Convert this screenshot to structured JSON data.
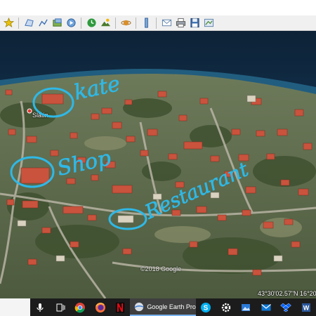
{
  "map": {
    "place_label": "Slatin",
    "copyright": "©2018 Google",
    "coordinates": "43°30'02.57\"N  16°20"
  },
  "annotations": {
    "colors": {
      "ink": "#2fb8e6"
    },
    "items": [
      {
        "text": "kate"
      },
      {
        "text": "Shop"
      },
      {
        "text": "Restaurant"
      }
    ]
  },
  "toolbar": {
    "icons": [
      "pin-icon",
      "polygon-icon",
      "path-icon",
      "overlay-icon",
      "tour-icon",
      "history-icon",
      "sun-icon",
      "planets-icon",
      "ruler-icon",
      "email-icon",
      "print-icon",
      "save-image-icon",
      "maps-icon"
    ]
  },
  "taskbar": {
    "active_app_label": "Google Earth Pro",
    "icons": [
      "microphone-icon",
      "task-view-icon",
      "chrome-icon",
      "firefox-icon",
      "netflix-icon",
      "google-earth-icon",
      "skype-icon",
      "settings-icon",
      "photos-icon",
      "mail-icon",
      "dropbox-icon",
      "word-icon"
    ]
  }
}
